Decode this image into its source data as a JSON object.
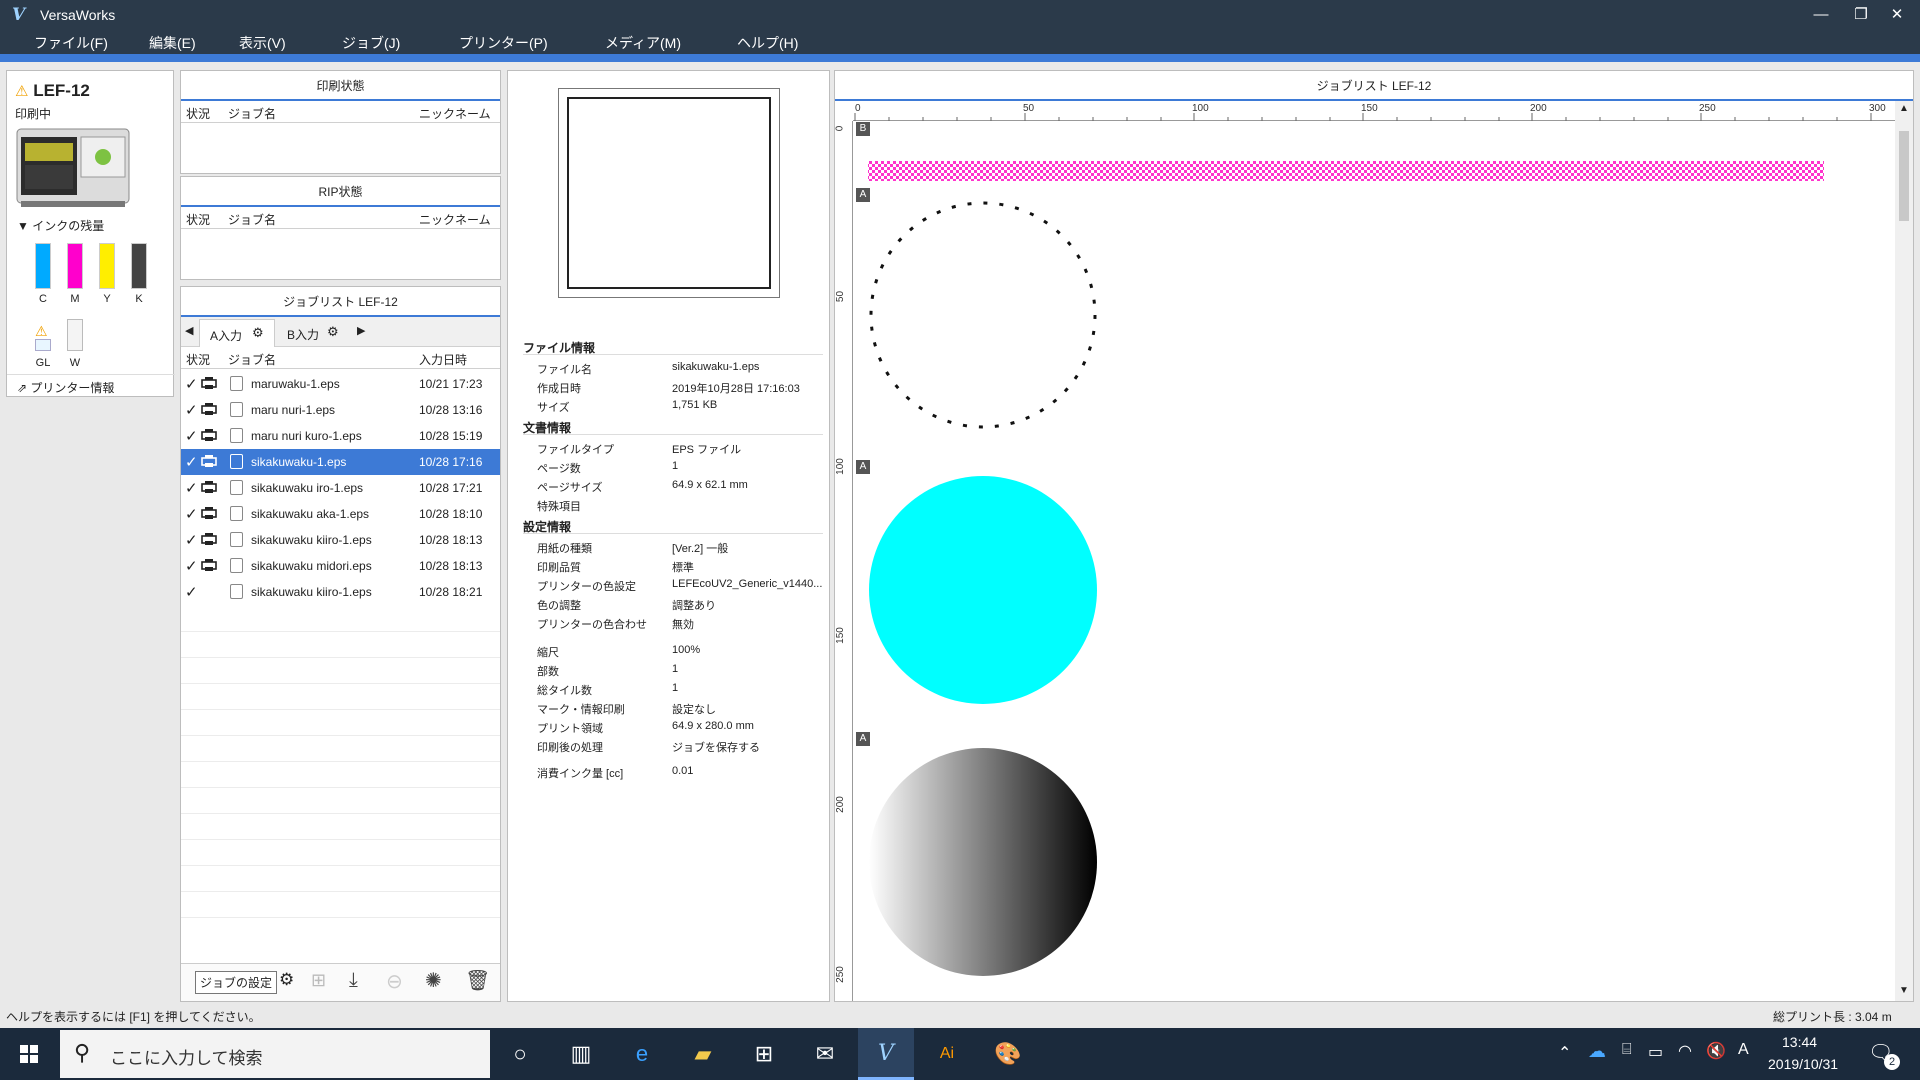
{
  "window": {
    "title": "VersaWorks",
    "app_glyph": "V"
  },
  "menu": [
    "ファイル(F)",
    "編集(E)",
    "表示(V)",
    "ジョブ(J)",
    "プリンター(P)",
    "メディア(M)",
    "ヘルプ(H)"
  ],
  "printer": {
    "name": "LEF-12",
    "status": "印刷中",
    "ink_header": "インクの残量",
    "inks": [
      {
        "label": "C",
        "color": "#00aaff"
      },
      {
        "label": "M",
        "color": "#ff00cc"
      },
      {
        "label": "Y",
        "color": "#ffee00"
      },
      {
        "label": "K",
        "color": "#333333"
      }
    ],
    "extra_inks": [
      {
        "label": "GL",
        "color": "#e8f6ff"
      },
      {
        "label": "W",
        "color": "#f4f4f4"
      }
    ],
    "info_link": "プリンター情報"
  },
  "print_status": {
    "title": "印刷状態",
    "columns": {
      "status": "状況",
      "job": "ジョブ名",
      "nickname": "ニックネーム"
    }
  },
  "rip_status": {
    "title": "RIP状態",
    "columns": {
      "status": "状況",
      "job": "ジョブ名",
      "nickname": "ニックネーム"
    }
  },
  "joblist": {
    "title": "ジョブリスト LEF-12",
    "tabs": [
      "A入力",
      "B入力"
    ],
    "columns": {
      "status": "状況",
      "job": "ジョブ名",
      "date": "入力日時"
    },
    "rows": [
      {
        "name": "maruwaku-1.eps",
        "date": "10/21 17:23",
        "printed": true
      },
      {
        "name": "maru nuri-1.eps",
        "date": "10/28 13:16",
        "printed": true
      },
      {
        "name": "maru nuri kuro-1.eps",
        "date": "10/28 15:19",
        "printed": true
      },
      {
        "name": "sikakuwaku-1.eps",
        "date": "10/28 17:16",
        "printed": true,
        "selected": true
      },
      {
        "name": "sikakuwaku iro-1.eps",
        "date": "10/28 17:21",
        "printed": true
      },
      {
        "name": "sikakuwaku aka-1.eps",
        "date": "10/28 18:10",
        "printed": true
      },
      {
        "name": "sikakuwaku kiiro-1.eps",
        "date": "10/28 18:13",
        "printed": true
      },
      {
        "name": "sikakuwaku midori.eps",
        "date": "10/28 18:13",
        "printed": true
      },
      {
        "name": "sikakuwaku kiiro-1.eps",
        "date": "10/28 18:21",
        "printed": false
      }
    ],
    "tooltip": "ジョブの設定"
  },
  "info": {
    "file_section": "ファイル情報",
    "file": [
      {
        "label": "ファイル名",
        "value": "sikakuwaku-1.eps"
      },
      {
        "label": "作成日時",
        "value": "2019年10月28日 17:16:03"
      },
      {
        "label": "サイズ",
        "value": "1,751 KB"
      }
    ],
    "doc_section": "文書情報",
    "doc": [
      {
        "label": "ファイルタイプ",
        "value": "EPS ファイル"
      },
      {
        "label": "ページ数",
        "value": "1"
      },
      {
        "label": "ページサイズ",
        "value": "64.9 x 62.1 mm"
      },
      {
        "label": "特殊項目",
        "value": ""
      }
    ],
    "settings_section": "設定情報",
    "settings": [
      {
        "label": "用紙の種類",
        "value": "[Ver.2] 一般"
      },
      {
        "label": "印刷品質",
        "value": "標準"
      },
      {
        "label": "プリンターの色設定",
        "value": "LEFEcoUV2_Generic_v1440..."
      },
      {
        "label": "色の調整",
        "value": "調整あり"
      },
      {
        "label": "プリンターの色合わせ",
        "value": "無効"
      }
    ],
    "settings2": [
      {
        "label": "縮尺",
        "value": "100%"
      },
      {
        "label": "部数",
        "value": "1"
      },
      {
        "label": "総タイル数",
        "value": "1"
      },
      {
        "label": "マーク・情報印刷",
        "value": "設定なし"
      },
      {
        "label": "プリント領域",
        "value": "64.9 x 280.0 mm"
      },
      {
        "label": "印刷後の処理",
        "value": "ジョブを保存する"
      }
    ],
    "ink_usage": {
      "label": "消費インク量 [cc]",
      "value": "0.01"
    }
  },
  "canvas": {
    "title": "ジョブリスト LEF-12",
    "ruler_x": [
      "0",
      "50",
      "100",
      "150",
      "200",
      "250",
      "300"
    ],
    "ruler_y": [
      "0",
      "50",
      "100",
      "150",
      "200",
      "250"
    ],
    "markers": [
      "B",
      "A",
      "A",
      "A"
    ],
    "colors": {
      "cyan": "#00ffff",
      "magenta": "#ff33cc"
    }
  },
  "statusbar": {
    "help": "ヘルプを表示するには [F1] を押してください。",
    "total": "総プリント長 : 3.04 m"
  },
  "taskbar": {
    "search_placeholder": "ここに入力して検索",
    "time": "13:44",
    "date": "2019/10/31",
    "notifications": "2"
  }
}
